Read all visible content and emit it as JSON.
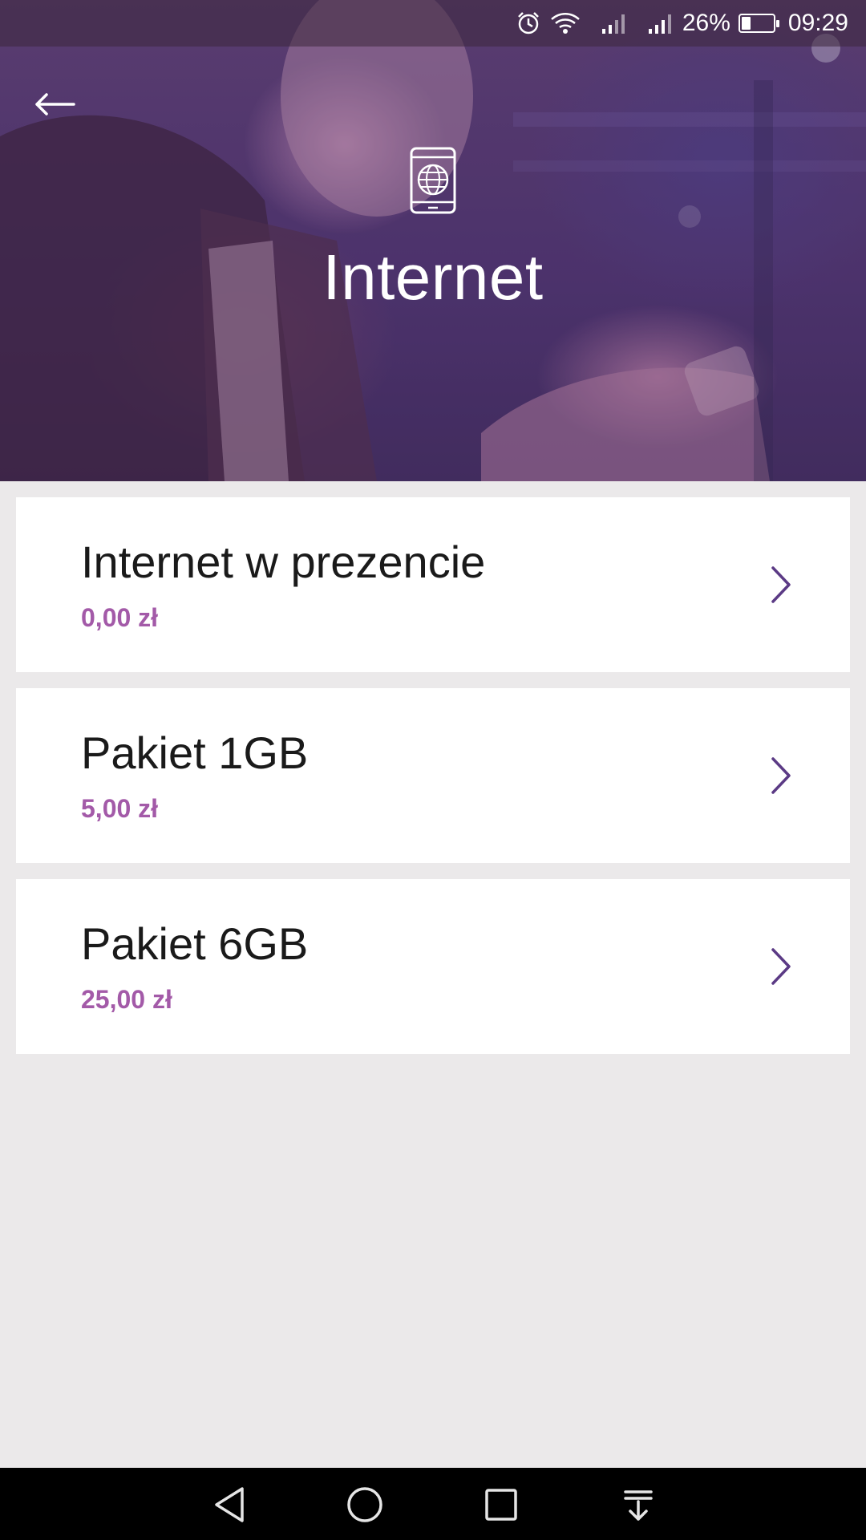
{
  "status_bar": {
    "battery_percent": "26%",
    "battery_level": 0.26,
    "time": "09:29",
    "icons": [
      "alarm-icon",
      "wifi-icon",
      "signal-icon",
      "signal-icon"
    ]
  },
  "header": {
    "back_icon": "arrow-left-icon",
    "icon": "tablet-globe-icon",
    "title": "Internet"
  },
  "offers": [
    {
      "name": "Internet w prezencie",
      "price": "0,00 zł",
      "icon": "chevron-right-icon"
    },
    {
      "name": "Pakiet 1GB",
      "price": "5,00 zł",
      "icon": "chevron-right-icon"
    },
    {
      "name": "Pakiet 6GB",
      "price": "25,00 zł",
      "icon": "chevron-right-icon"
    }
  ],
  "nav": {
    "icons": [
      "back-triangle-icon",
      "home-circle-icon",
      "recents-square-icon",
      "notifications-down-icon"
    ]
  },
  "colors": {
    "accent": "#a35aa8",
    "chevron": "#5b3a85",
    "background": "#ebe9ea"
  }
}
